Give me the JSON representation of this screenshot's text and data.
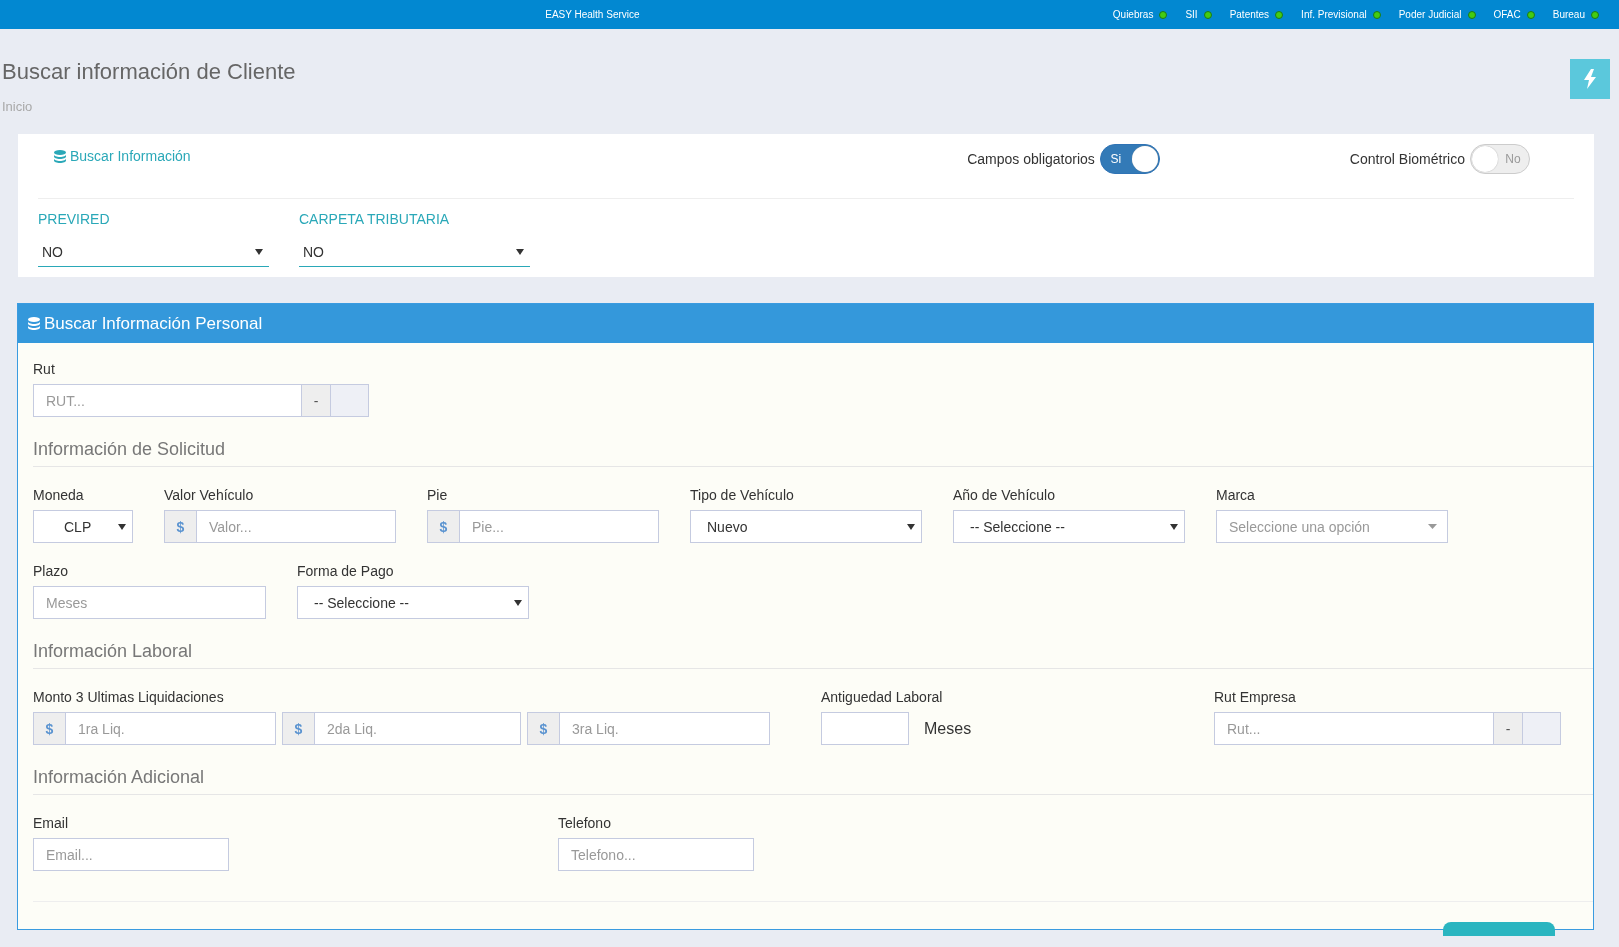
{
  "topbar": {
    "title": "EASY Health Service",
    "services": [
      {
        "label": "Quiebras",
        "online": true
      },
      {
        "label": "SII",
        "online": true
      },
      {
        "label": "Patentes",
        "online": true
      },
      {
        "label": "Inf. Previsional",
        "online": true
      },
      {
        "label": "Poder Judicial",
        "online": true
      },
      {
        "label": "OFAC",
        "online": true
      },
      {
        "label": "Bureau",
        "online": true
      }
    ]
  },
  "header": {
    "title": "Buscar información de Cliente",
    "breadcrumb": "Inicio"
  },
  "search_card": {
    "title": "Buscar Información",
    "toggles": [
      {
        "label": "Campos obligatorios",
        "on": true,
        "text": "Si"
      },
      {
        "label": "Control Biométrico",
        "on": false,
        "text": "No"
      }
    ],
    "selects": [
      {
        "label": "PREVIRED",
        "value": "NO"
      },
      {
        "label": "CARPETA TRIBUTARIA",
        "value": "NO"
      }
    ]
  },
  "personal_panel": {
    "title": "Buscar Información Personal",
    "rut": {
      "label": "Rut",
      "placeholder": "RUT...",
      "separator": "-"
    },
    "sections": [
      {
        "title": "Información de Solicitud",
        "rows": [
          [
            {
              "kind": "select",
              "label": "Moneda",
              "value": "CLP"
            },
            {
              "kind": "money",
              "label": "Valor Vehículo",
              "addon": "$",
              "placeholder": "Valor..."
            },
            {
              "kind": "money",
              "label": "Pie",
              "addon": "$",
              "placeholder": "Pie..."
            },
            {
              "kind": "select",
              "label": "Tipo de Vehículo",
              "value": "Nuevo"
            },
            {
              "kind": "select",
              "label": "Año de Vehículo",
              "value": "-- Seleccione --"
            },
            {
              "kind": "combo",
              "label": "Marca",
              "placeholder": "Seleccione una opción"
            }
          ],
          [
            {
              "kind": "input",
              "label": "Plazo",
              "placeholder": "Meses"
            },
            {
              "kind": "select",
              "label": "Forma de Pago",
              "value": "-- Seleccione --"
            }
          ]
        ]
      },
      {
        "title": "Información Laboral",
        "rows": [
          [
            {
              "kind": "multi",
              "label": "Monto 3 Ultimas Liquidaciones",
              "parts": [
                {
                  "addon": "$",
                  "placeholder": "1ra Liq."
                },
                {
                  "addon": "$",
                  "placeholder": "2da Liq."
                },
                {
                  "addon": "$",
                  "placeholder": "3ra Liq."
                }
              ]
            },
            {
              "kind": "suffix",
              "label": "Antiguedad Laboral",
              "suffix": "Meses"
            },
            {
              "kind": "rut",
              "label": "Rut Empresa",
              "placeholder": "Rut...",
              "separator": "-"
            }
          ]
        ]
      },
      {
        "title": "Información Adicional",
        "rows": [
          [
            {
              "kind": "input",
              "label": "Email",
              "placeholder": "Email..."
            },
            {
              "kind": "input",
              "label": "Telefono",
              "placeholder": "Telefono..."
            }
          ]
        ]
      }
    ]
  }
}
